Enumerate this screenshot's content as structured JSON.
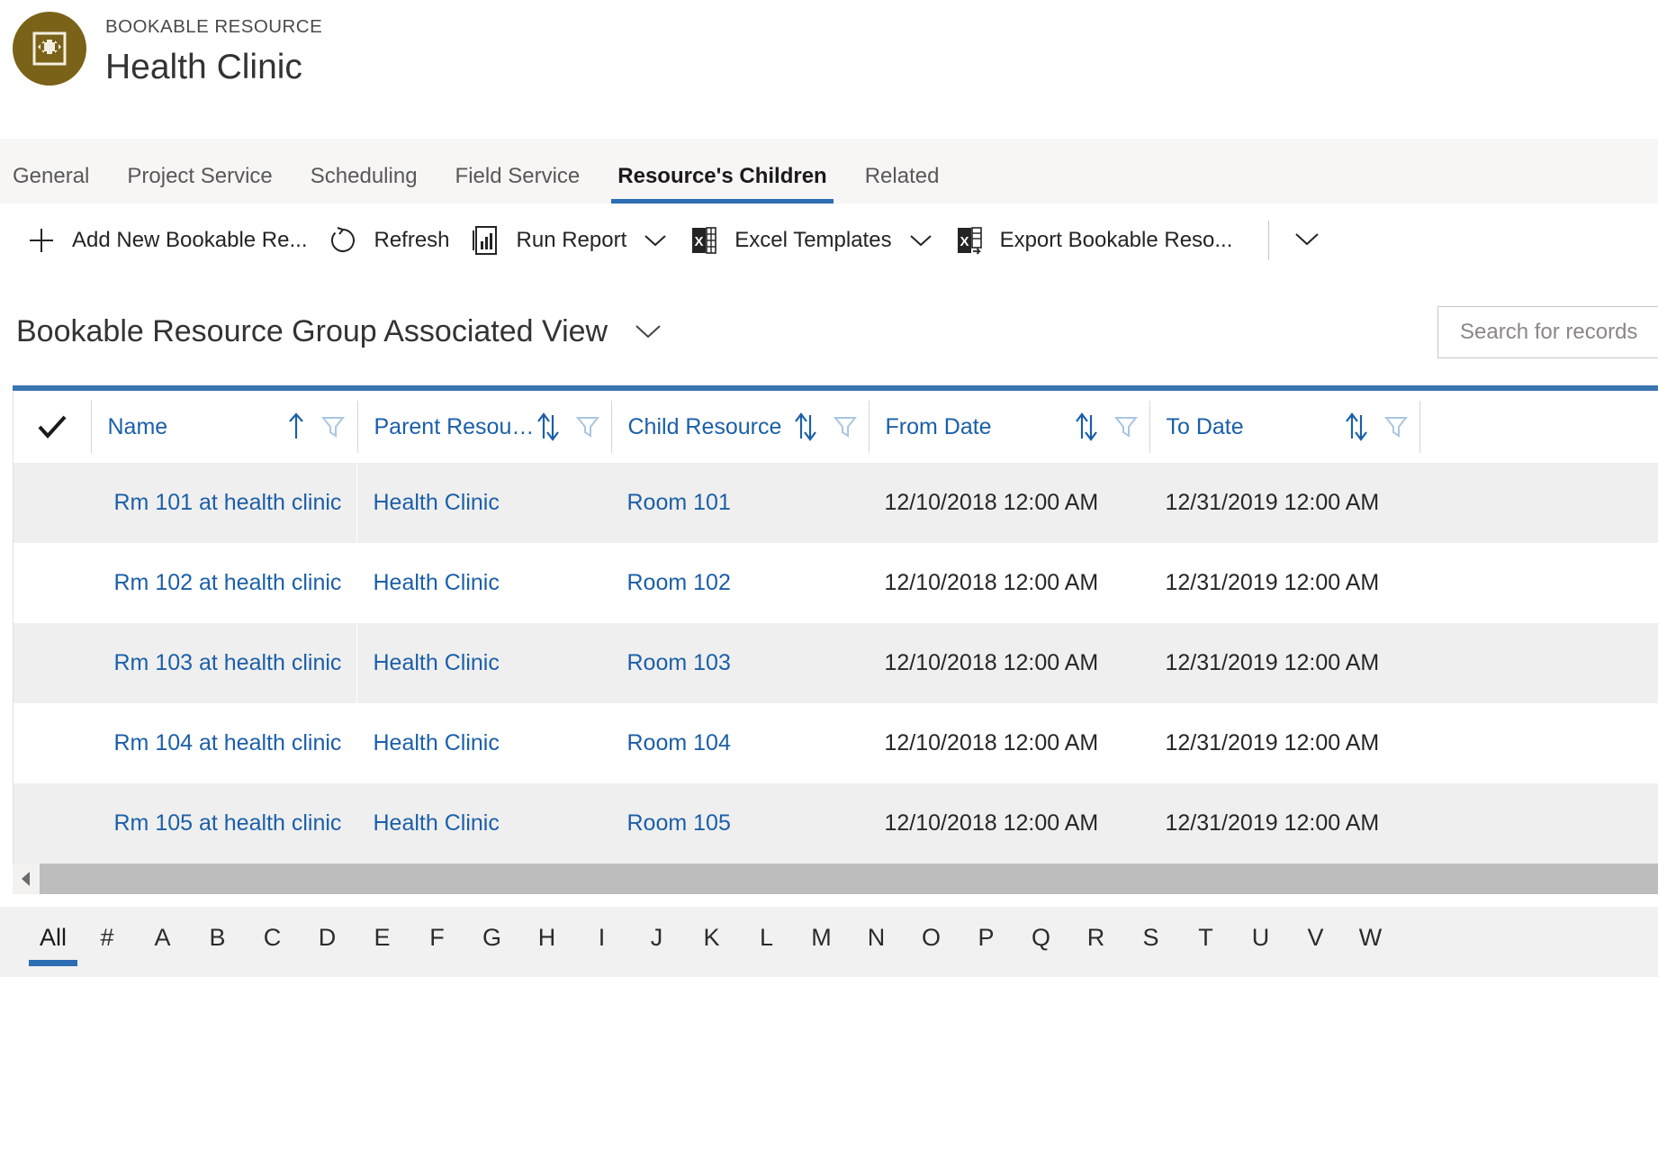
{
  "header": {
    "entity_label": "BOOKABLE RESOURCE",
    "record_title": "Health Clinic",
    "avatar_icon": "bookable-resource-icon",
    "avatar_color": "#7a6218"
  },
  "tabs": [
    {
      "label": "General",
      "selected": false
    },
    {
      "label": "Project Service",
      "selected": false
    },
    {
      "label": "Scheduling",
      "selected": false
    },
    {
      "label": "Field Service",
      "selected": false
    },
    {
      "label": "Resource's Children",
      "selected": true
    },
    {
      "label": "Related",
      "selected": false
    }
  ],
  "command_bar": {
    "commands": [
      {
        "label": "Add New Bookable Re...",
        "icon": "plus-icon",
        "has_chevron": false
      },
      {
        "label": "Refresh",
        "icon": "refresh-icon",
        "has_chevron": false
      },
      {
        "label": "Run Report",
        "icon": "report-icon",
        "has_chevron": true
      },
      {
        "label": "Excel Templates",
        "icon": "excel-icon",
        "has_chevron": true
      },
      {
        "label": "Export Bookable Reso...",
        "icon": "excel-export-icon",
        "has_chevron": false
      }
    ],
    "overflow_icon": "chevron-down-icon"
  },
  "view": {
    "title": "Bookable Resource Group Associated View",
    "selector_icon": "chevron-down-icon"
  },
  "search": {
    "placeholder": "Search for records",
    "value": ""
  },
  "grid": {
    "accent_color": "#3a75b0",
    "link_color": "#1b5fa8",
    "select_all_icon": "checkmark-icon",
    "columns": [
      {
        "label": "Name",
        "sort": "asc",
        "sort_icon": "sort-asc-icon",
        "filter_icon": "filter-icon"
      },
      {
        "label": "Parent Resour...",
        "sort": "none",
        "sort_icon": "sort-both-icon",
        "filter_icon": "filter-icon"
      },
      {
        "label": "Child Resource",
        "sort": "none",
        "sort_icon": "sort-both-icon",
        "filter_icon": "filter-icon"
      },
      {
        "label": "From Date",
        "sort": "none",
        "sort_icon": "sort-both-icon",
        "filter_icon": "filter-icon"
      },
      {
        "label": "To Date",
        "sort": "none",
        "sort_icon": "sort-both-icon",
        "filter_icon": "filter-icon"
      }
    ],
    "rows": [
      {
        "name": "Rm 101 at health clinic",
        "parent_resource": "Health Clinic",
        "child_resource": "Room 101",
        "from_date": "12/10/2018 12:00 AM",
        "to_date": "12/31/2019 12:00 AM"
      },
      {
        "name": "Rm 102 at health clinic",
        "parent_resource": "Health Clinic",
        "child_resource": "Room 102",
        "from_date": "12/10/2018 12:00 AM",
        "to_date": "12/31/2019 12:00 AM"
      },
      {
        "name": "Rm 103 at health clinic",
        "parent_resource": "Health Clinic",
        "child_resource": "Room 103",
        "from_date": "12/10/2018 12:00 AM",
        "to_date": "12/31/2019 12:00 AM"
      },
      {
        "name": "Rm 104 at health clinic",
        "parent_resource": "Health Clinic",
        "child_resource": "Room 104",
        "from_date": "12/10/2018 12:00 AM",
        "to_date": "12/31/2019 12:00 AM"
      },
      {
        "name": "Rm 105 at health clinic",
        "parent_resource": "Health Clinic",
        "child_resource": "Room 105",
        "from_date": "12/10/2018 12:00 AM",
        "to_date": "12/31/2019 12:00 AM"
      }
    ]
  },
  "alpha_filter": {
    "selected": "All",
    "items": [
      "All",
      "#",
      "A",
      "B",
      "C",
      "D",
      "E",
      "F",
      "G",
      "H",
      "I",
      "J",
      "K",
      "L",
      "M",
      "N",
      "O",
      "P",
      "Q",
      "R",
      "S",
      "T",
      "U",
      "V",
      "W"
    ]
  }
}
